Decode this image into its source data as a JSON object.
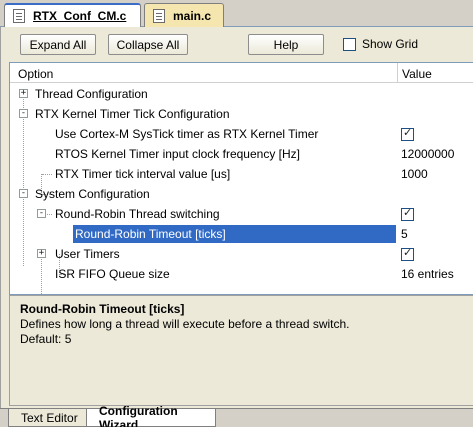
{
  "file_tabs": [
    {
      "label": "RTX_Conf_CM.c",
      "active": true
    },
    {
      "label": "main.c",
      "active": false
    }
  ],
  "toolbar": {
    "expand_all": "Expand All",
    "collapse_all": "Collapse All",
    "help": "Help",
    "show_grid": "Show Grid",
    "show_grid_checked": false
  },
  "grid": {
    "columns": [
      "Option",
      "Value"
    ],
    "rows": [
      {
        "label": "Thread Configuration",
        "expander": "+",
        "value": ""
      },
      {
        "label": "RTX Kernel Timer Tick Configuration",
        "expander": "-",
        "value": ""
      },
      {
        "label": "Use Cortex-M SysTick timer as RTX Kernel Timer",
        "value": "checked"
      },
      {
        "label": "RTOS Kernel Timer input clock frequency [Hz]",
        "value": "12000000"
      },
      {
        "label": "RTX Timer tick interval value [us]",
        "value": "1000"
      },
      {
        "label": "System Configuration",
        "expander": "-",
        "value": ""
      },
      {
        "label": "Round-Robin Thread switching",
        "expander": "-",
        "value": "checked"
      },
      {
        "label": "Round-Robin Timeout [ticks]",
        "value": "5",
        "selected": true
      },
      {
        "label": "User Timers",
        "expander": "+",
        "value": "checked"
      },
      {
        "label": "ISR FIFO Queue size",
        "value": "16 entries"
      }
    ]
  },
  "description": {
    "title": "Round-Robin Timeout [ticks]",
    "text": "Defines how long a thread will execute before a thread switch.",
    "default": "Default: 5"
  },
  "bottom_tabs": [
    {
      "label": "Text Editor",
      "active": false
    },
    {
      "label": "Configuration Wizard",
      "active": true
    }
  ],
  "colors": {
    "selection": "#316ac5",
    "panel": "#ece9d8",
    "inactive_file_tab": "#f5e6b0"
  }
}
